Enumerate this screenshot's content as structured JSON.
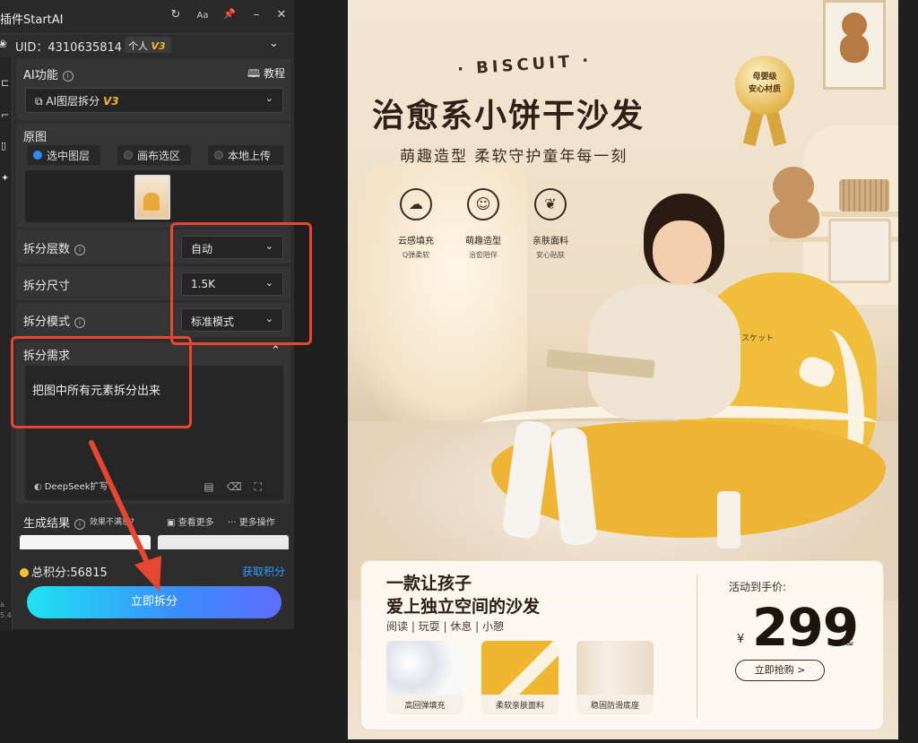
{
  "plugin": {
    "title": "插件StartAI",
    "title_buttons": [
      "↻",
      "Aa",
      "📌",
      "–",
      "✕"
    ],
    "uid": "UID：4310635814",
    "account_badge": "个人",
    "account_version": "V3",
    "strip_version": [
      "a",
      "5.4"
    ],
    "ai_function": {
      "label": "AI功能",
      "tutorial": "教程",
      "selected": "AI图层拆分",
      "selected_version": "V3"
    },
    "source": {
      "label": "原图",
      "options": [
        {
          "label": "选中图层",
          "checked": true
        },
        {
          "label": "画布选区",
          "checked": false
        },
        {
          "label": "本地上传",
          "checked": false
        }
      ]
    },
    "settings": [
      {
        "label": "拆分层数",
        "has_info": true,
        "value": "自动"
      },
      {
        "label": "拆分尺寸",
        "has_info": false,
        "value": "1.5K"
      },
      {
        "label": "拆分模式",
        "has_info": true,
        "value": "标准模式"
      }
    ],
    "requirement": {
      "label": "拆分需求",
      "text": "把图中所有元素拆分出来",
      "engine": "DeepSeek扩写"
    },
    "results": {
      "label": "生成结果",
      "note": "效果不满意?",
      "view_more": "查看更多",
      "more_actions": "更多操作"
    },
    "points": "总积分:56815",
    "get_points": "获取积分",
    "primary_button": "立即拆分"
  },
  "poster": {
    "brand": "· BISCUIT ·",
    "title": "治愈系小饼干沙发",
    "subtitle": "萌趣造型  柔软守护童年每一刻",
    "medal": [
      "母婴级",
      "安心材质"
    ],
    "features": [
      {
        "title": "云感填充",
        "sub": "Q弹柔软",
        "icon": "☁"
      },
      {
        "title": "萌趣造型",
        "sub": "治愈陪伴",
        "icon": "☺"
      },
      {
        "title": "亲肤面料",
        "sub": "安心贴肤",
        "icon": "❦"
      }
    ],
    "sofa_text": "ビスケット",
    "card": {
      "headline_1": "一款让孩子",
      "headline_2": "爱上独立空间的沙发",
      "tags": "阅读 | 玩耍 | 休息 | 小憩",
      "products": [
        "高回弹填充",
        "柔软亲肤面料",
        "稳固防滑底座"
      ],
      "promo": "活动到手价:",
      "currency": "¥",
      "price": "299",
      "price_suffix": "起",
      "buy_button": "立即抢购 >"
    }
  },
  "colors": {
    "accent": "#3b8cff",
    "annotation": "#e8462e",
    "panel": "#2d2d2d",
    "sofa": "#eeb435"
  }
}
